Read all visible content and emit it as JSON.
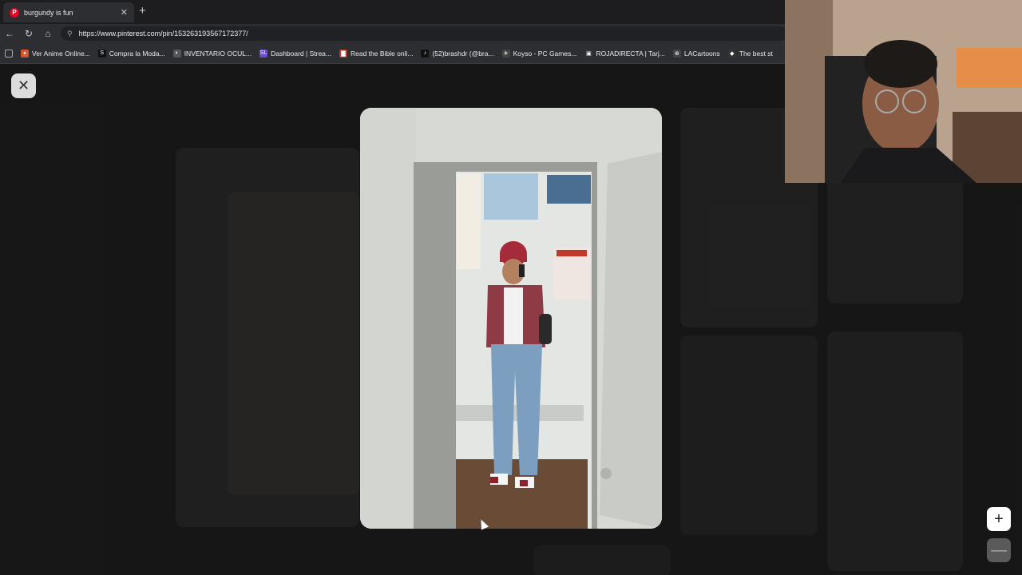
{
  "browser": {
    "tab_title": "burgundy is fun",
    "tab_icon": "P",
    "new_tab": "+",
    "tab_close": "✕",
    "url": "https://www.pinterest.com/pin/153263193567172377/"
  },
  "bookmarks": [
    {
      "label": "Ver Anime Online...",
      "icon": "✦",
      "color": "#d9532c"
    },
    {
      "label": "Compra la Moda...",
      "icon": "S",
      "color": "#111111"
    },
    {
      "label": "INVENTARIO OCUL...",
      "icon": "◐",
      "color": "#555555"
    },
    {
      "label": "Dashboard | Strea...",
      "icon": "SL",
      "color": "#6a4cc7"
    },
    {
      "label": "Read the Bible onli...",
      "icon": "▇",
      "color": "#c0392b"
    },
    {
      "label": "(52)brashdr (@bra...",
      "icon": "♪",
      "color": "#111111"
    },
    {
      "label": "Koyso - PC Games...",
      "icon": "✈",
      "color": "#444444"
    },
    {
      "label": "ROJADIRECTA | Tarj...",
      "icon": "▣",
      "color": "#333333"
    },
    {
      "label": "LACartoons",
      "icon": "⊕",
      "color": "#444444"
    },
    {
      "label": "The best st",
      "icon": "◆",
      "color": "#333333"
    }
  ],
  "viewer": {
    "close_icon": "✕",
    "visual_search_icon": "⟳",
    "zoom_in": "+",
    "zoom_out": "—"
  }
}
